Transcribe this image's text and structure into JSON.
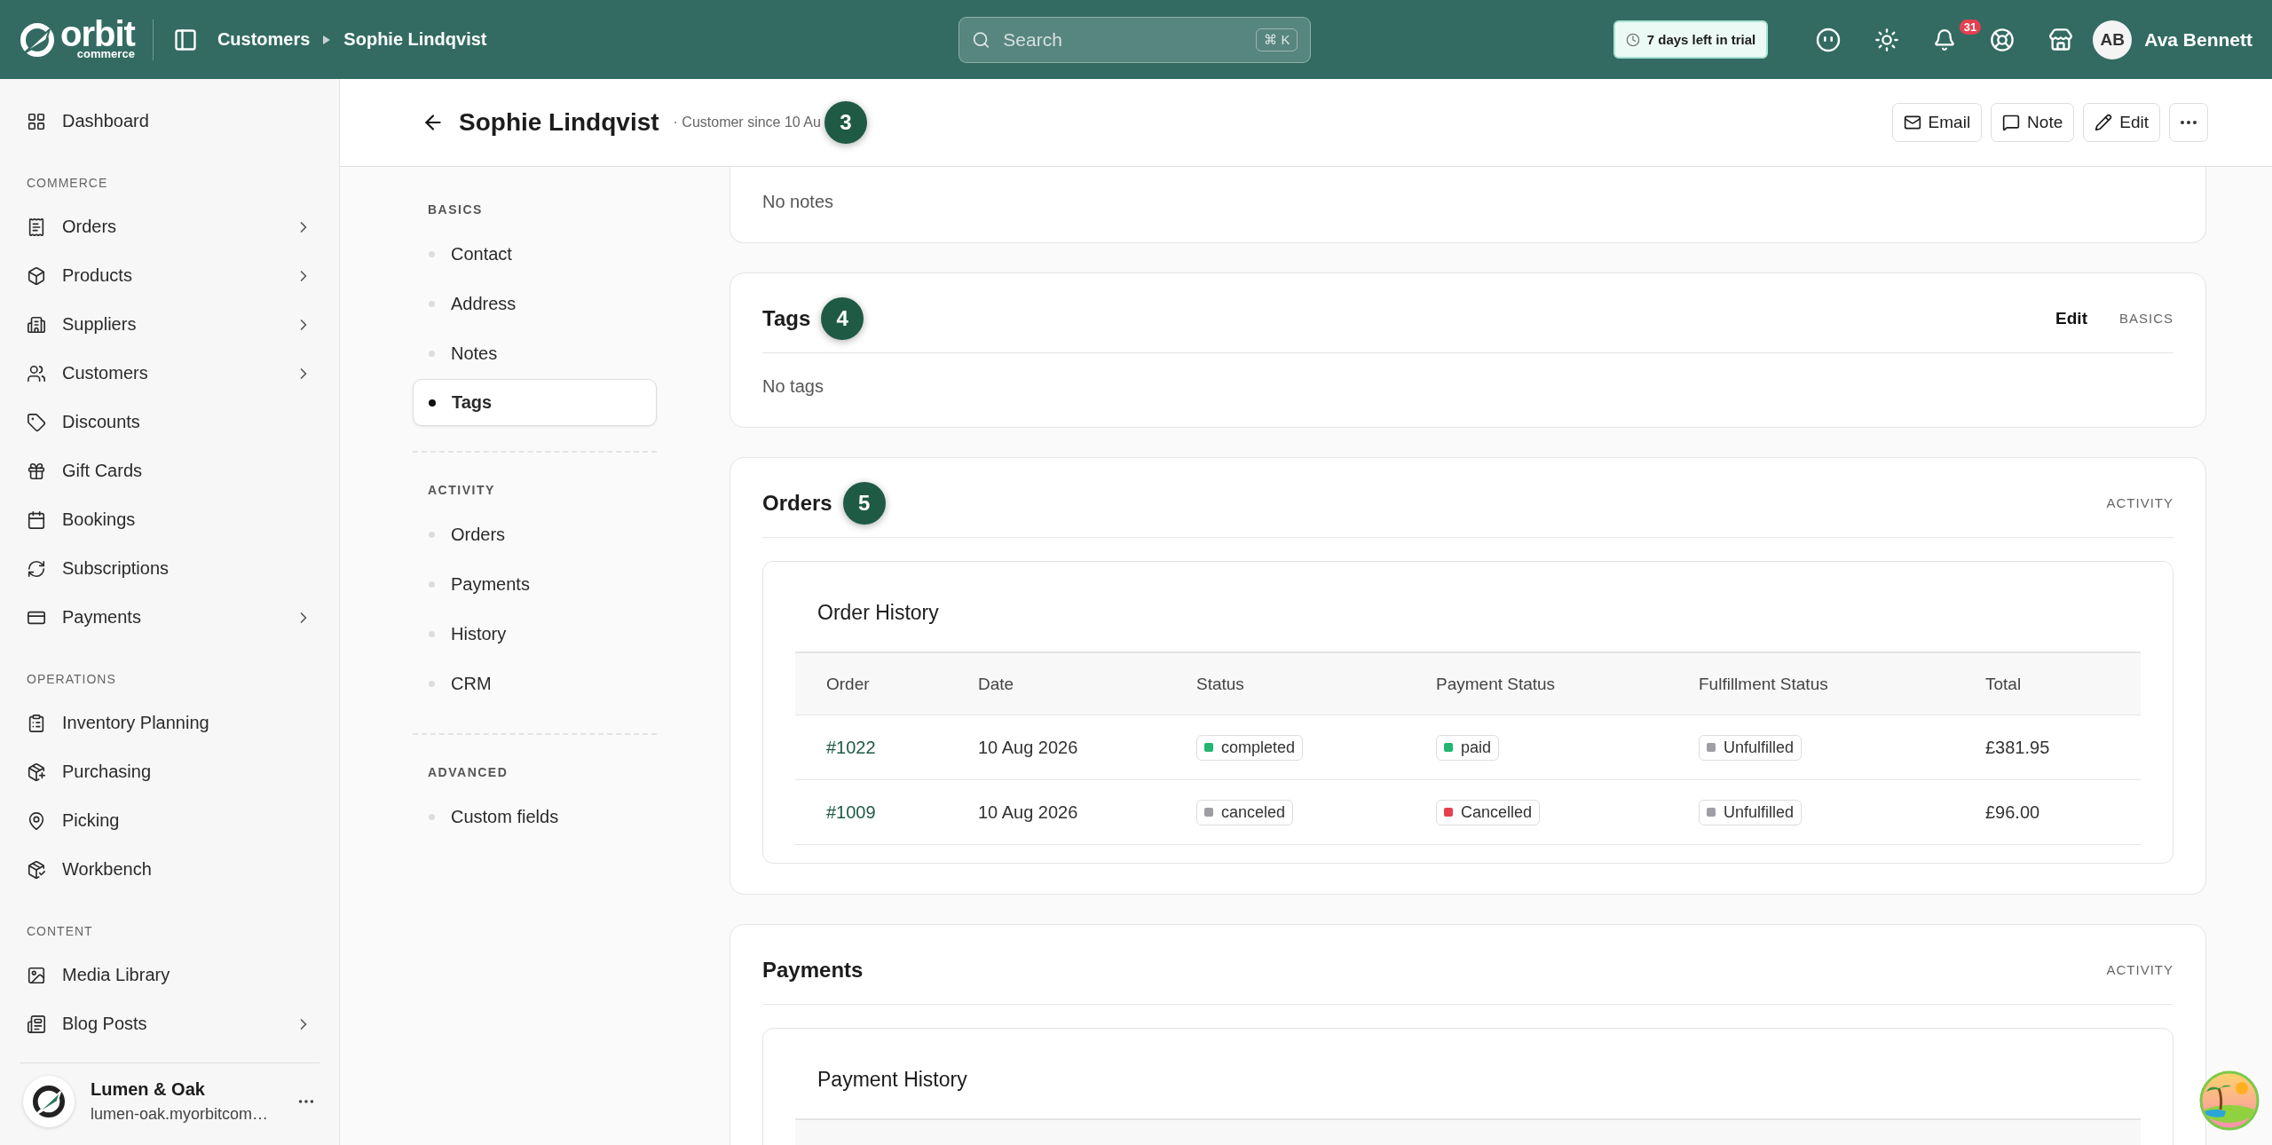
{
  "topbar": {
    "logo": {
      "name": "orbit",
      "tagline": "commerce"
    },
    "breadcrumbs": [
      {
        "label": "Customers"
      },
      {
        "label": "Sophie Lindqvist"
      }
    ],
    "search": {
      "placeholder": "Search",
      "shortcut": "⌘ K"
    },
    "trial": "7 days left in trial",
    "notifications": "31",
    "user": {
      "initials": "AB",
      "name": "Ava Bennett"
    }
  },
  "sidebar": {
    "top": [
      {
        "label": "Dashboard",
        "expandable": false
      }
    ],
    "sections": [
      {
        "title": "COMMERCE",
        "items": [
          {
            "label": "Orders",
            "expandable": true
          },
          {
            "label": "Products",
            "expandable": true
          },
          {
            "label": "Suppliers",
            "expandable": true
          },
          {
            "label": "Customers",
            "expandable": true
          },
          {
            "label": "Discounts",
            "expandable": false
          },
          {
            "label": "Gift Cards",
            "expandable": false
          },
          {
            "label": "Bookings",
            "expandable": false
          },
          {
            "label": "Subscriptions",
            "expandable": false
          },
          {
            "label": "Payments",
            "expandable": true
          }
        ]
      },
      {
        "title": "OPERATIONS",
        "items": [
          {
            "label": "Inventory Planning",
            "expandable": false
          },
          {
            "label": "Purchasing",
            "expandable": false
          },
          {
            "label": "Picking",
            "expandable": false
          },
          {
            "label": "Workbench",
            "expandable": false
          }
        ]
      },
      {
        "title": "CONTENT",
        "items": [
          {
            "label": "Media Library",
            "expandable": false
          },
          {
            "label": "Blog Posts",
            "expandable": true
          }
        ]
      }
    ],
    "store": {
      "name": "Lumen & Oak",
      "domain": "lumen-oak.myorbitcom…"
    }
  },
  "header": {
    "title": "Sophie Lindqvist",
    "subtitle": "· Customer since 10 Au",
    "marker": "3",
    "actions": [
      {
        "label": "Email"
      },
      {
        "label": "Note"
      },
      {
        "label": "Edit"
      }
    ]
  },
  "subnav": {
    "sections": [
      {
        "title": "BASICS",
        "items": [
          {
            "label": "Contact",
            "selected": false
          },
          {
            "label": "Address",
            "selected": false
          },
          {
            "label": "Notes",
            "selected": false
          },
          {
            "label": "Tags",
            "selected": true
          }
        ]
      },
      {
        "title": "ACTIVITY",
        "items": [
          {
            "label": "Orders",
            "selected": false
          },
          {
            "label": "Payments",
            "selected": false
          },
          {
            "label": "History",
            "selected": false
          },
          {
            "label": "CRM",
            "selected": false
          }
        ]
      },
      {
        "title": "ADVANCED",
        "items": [
          {
            "label": "Custom fields",
            "selected": false
          }
        ]
      }
    ]
  },
  "cards": [
    {
      "empty": "No notes"
    },
    {
      "title": "Tags",
      "marker": "4",
      "action": "Edit",
      "section": "BASICS",
      "empty": "No tags"
    },
    {
      "title": "Orders",
      "marker": "5",
      "section": "ACTIVITY",
      "table": {
        "title": "Order History",
        "columns": [
          "Order",
          "Date",
          "Status",
          "Payment Status",
          "Fulfillment Status",
          "Total"
        ],
        "rows": [
          [
            {
              "text": "#1022",
              "kind": "link"
            },
            {
              "text": "10 Aug 2026",
              "kind": "text"
            },
            {
              "text": "completed",
              "kind": "chip",
              "color": "#22b573"
            },
            {
              "text": "paid",
              "kind": "chip",
              "color": "#22b573"
            },
            {
              "text": "Unfulfilled",
              "kind": "chip",
              "color": "#9e9ea4"
            },
            {
              "text": "£381.95",
              "kind": "text"
            }
          ],
          [
            {
              "text": "#1009",
              "kind": "link"
            },
            {
              "text": "10 Aug 2026",
              "kind": "text"
            },
            {
              "text": "canceled",
              "kind": "chip",
              "color": "#9e9ea4"
            },
            {
              "text": "Cancelled",
              "kind": "chip",
              "color": "#e5404f"
            },
            {
              "text": "Unfulfilled",
              "kind": "chip",
              "color": "#9e9ea4"
            },
            {
              "text": "£96.00",
              "kind": "text"
            }
          ]
        ]
      }
    },
    {
      "title": "Payments",
      "section": "ACTIVITY",
      "table": {
        "title": "Payment History"
      }
    }
  ]
}
